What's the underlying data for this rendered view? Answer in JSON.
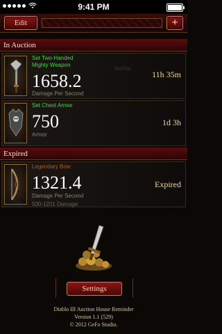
{
  "status_bar": {
    "time": "9:41 PM"
  },
  "toolbar": {
    "edit_label": "Edit",
    "add_label": "+"
  },
  "sections": {
    "in_auction": "In Auction",
    "expired": "Expired"
  },
  "auctions": [
    {
      "set_name": "Set Two-Handed",
      "item_name": "Mighty Weapon",
      "value": "1658.2",
      "stat_label": "Damage Per Second",
      "time_left": "11h 35m",
      "ghost_text": "Barbar"
    },
    {
      "set_name": "Set Chest Armor",
      "value": "750",
      "stat_label": "Armor",
      "time_left": "1d 3h"
    }
  ],
  "expired": [
    {
      "set_name": "Legendary Bow",
      "value": "1321.4",
      "stat_label": "Damage Per Second",
      "status": "Expired",
      "extra": "500-1201 Damage"
    }
  ],
  "settings_label": "Settings",
  "footer": {
    "app_name": "Diablo III Auction House Reminder",
    "version": "Version 1.1 (529)",
    "copyright": "© 2012 GeFo Studio."
  }
}
